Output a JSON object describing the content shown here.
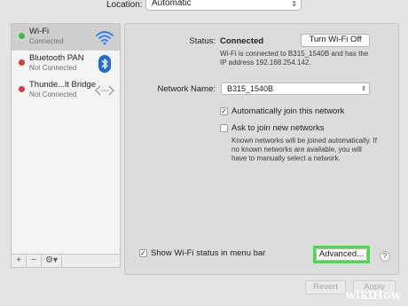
{
  "location": {
    "label": "Location:",
    "value": "Automatic"
  },
  "sidebar": {
    "services": [
      {
        "name": "Wi-Fi",
        "status": "Connected",
        "dot_color": "#3fbb3f",
        "icon": "wifi-icon"
      },
      {
        "name": "Bluetooth PAN",
        "status": "Not Connected",
        "dot_color": "#d93a3a",
        "icon": "bluetooth-icon"
      },
      {
        "name": "Thunde...lt Bridge",
        "status": "Not Connected",
        "dot_color": "#d93a3a",
        "icon": "thunderbolt-bridge-icon"
      }
    ],
    "toolbar": {
      "add": "+",
      "remove": "−",
      "gear": "⚙▾"
    }
  },
  "status": {
    "label": "Status:",
    "value": "Connected",
    "button": "Turn Wi-Fi Off",
    "description": "Wi-Fi is connected to B315_1540B and has the IP address 192.168.254.142."
  },
  "network": {
    "label": "Network Name:",
    "value": "B315_1540B",
    "auto_join": {
      "label": "Automatically join this network",
      "checked": true
    },
    "ask_join": {
      "label": "Ask to join new networks",
      "checked": false
    },
    "ask_description": "Known networks will be joined automatically. If no known networks are available, you will have to manually select a network."
  },
  "show_status": {
    "label": "Show Wi-Fi status in menu bar",
    "checked": true
  },
  "advanced_button": "Advanced...",
  "help": "?",
  "revert": "Revert",
  "apply": "Apply",
  "watermark": {
    "wiki": "wiki",
    "how": "How"
  },
  "colors": {
    "highlight": "#3fe33f",
    "bluetooth": "#1f6fd1"
  }
}
